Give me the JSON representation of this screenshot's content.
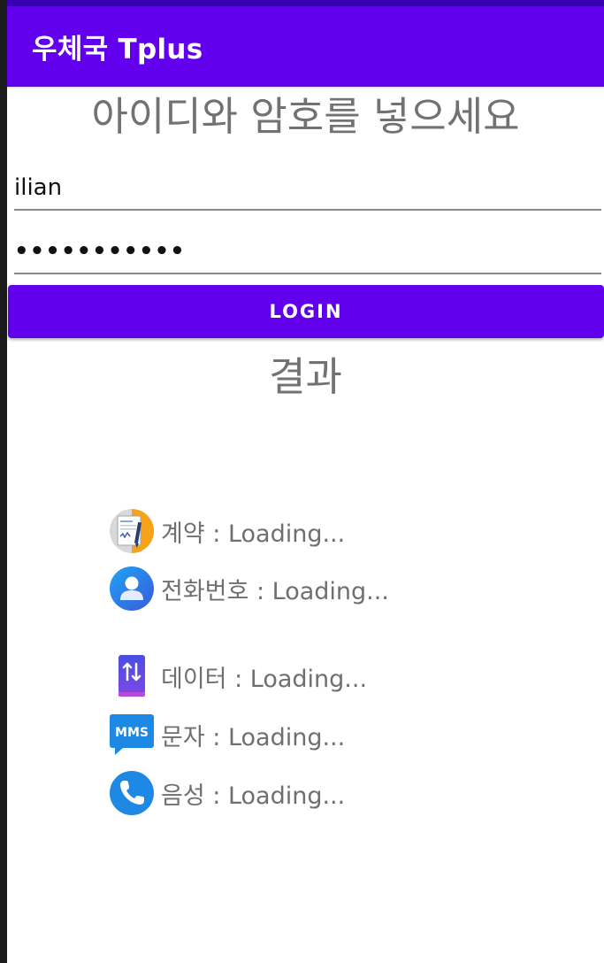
{
  "app": {
    "title": "우체국 Tplus",
    "primary_color": "#6200EE",
    "status_color": "#3700B3"
  },
  "login": {
    "heading": "아이디와 암호를 넣으세요",
    "id_value": "ilian",
    "password_value": "•••••••••••",
    "button_label": "LOGIN"
  },
  "result": {
    "title": "결과",
    "items": [
      {
        "icon": "contract-icon",
        "label": "계약 : Loading..."
      },
      {
        "icon": "user-icon",
        "label": "전화번호 : Loading..."
      },
      {
        "icon": "data-transfer-icon",
        "label": "데이터 : Loading..."
      },
      {
        "icon": "mms-icon",
        "label": "문자 : Loading..."
      },
      {
        "icon": "phone-icon",
        "label": "음성 : Loading..."
      }
    ]
  }
}
